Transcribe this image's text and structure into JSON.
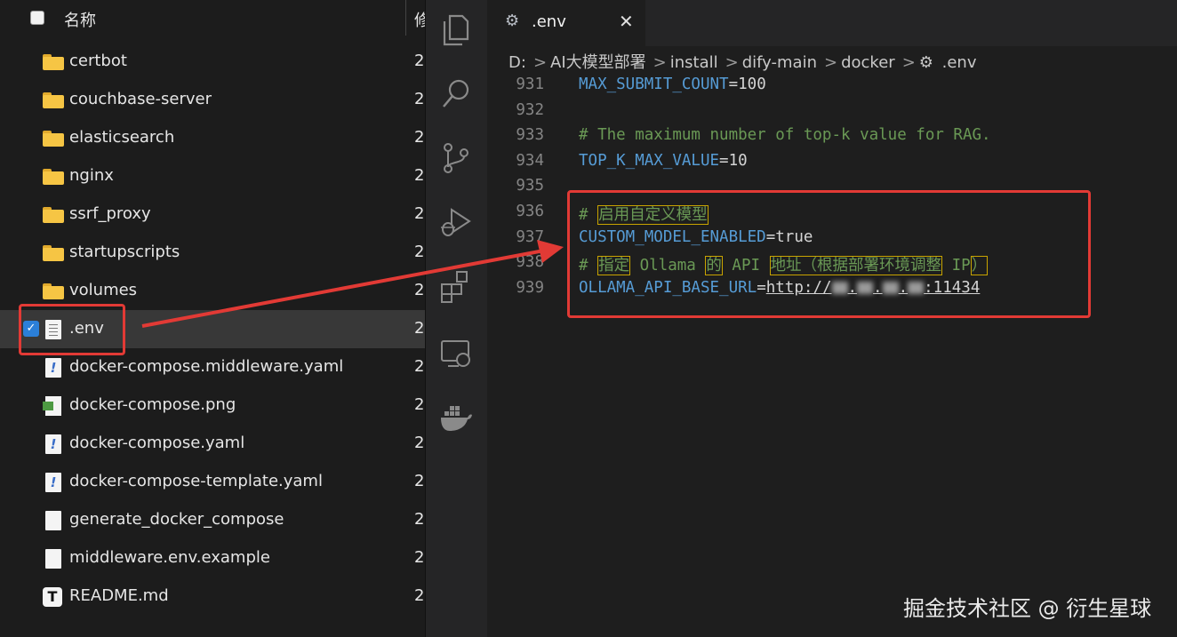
{
  "explorer": {
    "header": {
      "name": "名称",
      "modified": "修"
    },
    "files": [
      {
        "name": "certbot",
        "type": "folder",
        "date": "2"
      },
      {
        "name": "couchbase-server",
        "type": "folder",
        "date": "2"
      },
      {
        "name": "elasticsearch",
        "type": "folder",
        "date": "2"
      },
      {
        "name": "nginx",
        "type": "folder",
        "date": "2"
      },
      {
        "name": "ssrf_proxy",
        "type": "folder",
        "date": "2"
      },
      {
        "name": "startupscripts",
        "type": "folder",
        "date": "2"
      },
      {
        "name": "volumes",
        "type": "folder",
        "date": "2"
      },
      {
        "name": ".env",
        "type": "text",
        "date": "2",
        "selected": true
      },
      {
        "name": "docker-compose.middleware.yaml",
        "type": "yaml",
        "date": "2"
      },
      {
        "name": "docker-compose.png",
        "type": "image",
        "date": "2"
      },
      {
        "name": "docker-compose.yaml",
        "type": "yaml",
        "date": "2"
      },
      {
        "name": "docker-compose-template.yaml",
        "type": "yaml",
        "date": "2"
      },
      {
        "name": "generate_docker_compose",
        "type": "blank",
        "date": "2"
      },
      {
        "name": "middleware.env.example",
        "type": "blank",
        "date": "2"
      },
      {
        "name": "README.md",
        "type": "markdown",
        "date": "2"
      }
    ]
  },
  "activity_bar": {
    "icons": [
      "files-icon",
      "search-icon",
      "source-control-icon",
      "run-debug-icon",
      "extensions-icon",
      "remote-explorer-icon",
      "docker-icon"
    ]
  },
  "editor": {
    "tab": {
      "title": ".env",
      "close": "✕"
    },
    "breadcrumb": [
      "D:",
      "AI大模型部署",
      "install",
      "dify-main",
      "docker",
      ".env"
    ],
    "lines": [
      {
        "num": "931",
        "key": "MAX_SUBMIT_COUNT",
        "eq": "=",
        "val": "100"
      },
      {
        "num": "932"
      },
      {
        "num": "933",
        "comment": "# The maximum number of top-k value for RAG."
      },
      {
        "num": "934",
        "key": "TOP_K_MAX_VALUE",
        "eq": "=",
        "val": "10"
      },
      {
        "num": "935"
      },
      {
        "num": "936",
        "hash": "# ",
        "hl1": "启用自定义模型"
      },
      {
        "num": "937",
        "key": "CUSTOM_MODEL_ENABLED",
        "eq": "=",
        "val": "true"
      },
      {
        "num": "938",
        "hash": "# ",
        "w1": "指定",
        "w2": " Ollama ",
        "w3": "的",
        "w4": " API ",
        "w5": "地址（根据部署环境调整",
        "w6": " IP",
        "w7": "）"
      },
      {
        "num": "939",
        "key": "OLLAMA_API_BASE_URL",
        "eq": "=",
        "url_prefix": "http://",
        "url_dots": ".",
        "port": ":11434"
      }
    ]
  },
  "watermark": "掘金技术社区 @ 衍生星球",
  "colors": {
    "highlight_box": "#e23a35",
    "selected_row": "#383838",
    "checkbox": "#2b7fd8"
  }
}
